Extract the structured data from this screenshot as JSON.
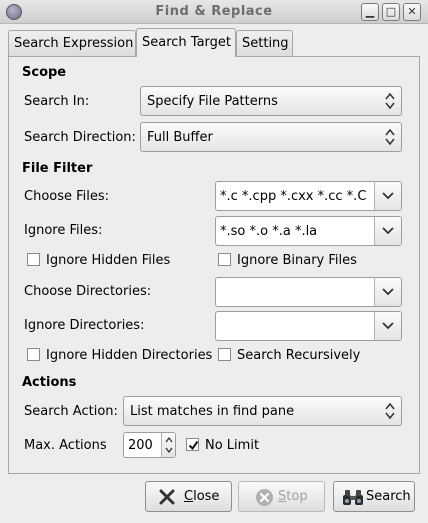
{
  "window": {
    "title": "Find & Replace",
    "minimize": "▁",
    "maximize": "□",
    "close": "✕"
  },
  "tabs": [
    {
      "label": "Search Expression",
      "active": false
    },
    {
      "label": "Search Target",
      "active": true
    },
    {
      "label": "Setting",
      "active": false
    }
  ],
  "scope": {
    "title": "Scope",
    "search_in_label": "Search In:",
    "search_in_value": "Specify File Patterns",
    "direction_label": "Search Direction:",
    "direction_value": "Full Buffer"
  },
  "file_filter": {
    "title": "File Filter",
    "choose_files_label": "Choose Files:",
    "choose_files_value": "*.c *.cpp *.cxx *.cc *.C *",
    "ignore_files_label": "Ignore Files:",
    "ignore_files_value": "*.so *.o *.a *.la",
    "ignore_hidden_files": {
      "label": "Ignore Hidden Files",
      "checked": false
    },
    "ignore_binary_files": {
      "label": "Ignore Binary Files",
      "checked": false
    },
    "choose_dirs_label": "Choose Directories:",
    "choose_dirs_value": "",
    "ignore_dirs_label": "Ignore Directories:",
    "ignore_dirs_value": "",
    "ignore_hidden_dirs": {
      "label": "Ignore Hidden Directories",
      "checked": false
    },
    "search_recursively": {
      "label": "Search Recursively",
      "checked": false
    }
  },
  "actions": {
    "title": "Actions",
    "search_action_label": "Search Action:",
    "search_action_value": "List matches in find pane",
    "max_actions_label": "Max. Actions",
    "max_actions_value": "200",
    "no_limit": {
      "label": "No Limit",
      "checked": true
    }
  },
  "buttons": {
    "close_mnemonic": "C",
    "close_rest": "lose",
    "stop_mnemonic": "S",
    "stop_rest": "top",
    "search_label": "Search"
  },
  "colors": {
    "window_bg": "#ededed",
    "stop_icon": "#b0b0b0",
    "close_icon": "#333333"
  }
}
